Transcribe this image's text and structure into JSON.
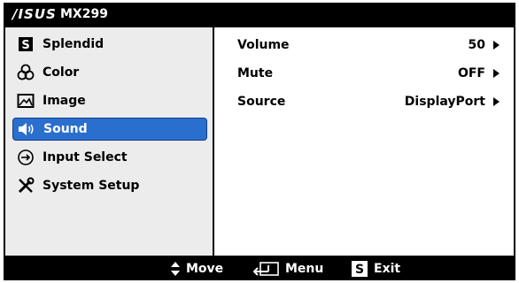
{
  "window": {
    "brand": "/ISUS",
    "model": "MX299"
  },
  "sidebar": {
    "items": [
      {
        "label": "Splendid",
        "icon": "splendid-s-icon"
      },
      {
        "label": "Color",
        "icon": "color-circles-icon"
      },
      {
        "label": "Image",
        "icon": "image-icon"
      },
      {
        "label": "Sound",
        "icon": "speaker-icon",
        "active": true
      },
      {
        "label": "Input Select",
        "icon": "input-arrow-icon"
      },
      {
        "label": "System Setup",
        "icon": "tools-icon"
      }
    ]
  },
  "settings": {
    "rows": [
      {
        "label": "Volume",
        "value": "50"
      },
      {
        "label": "Mute",
        "value": "OFF"
      },
      {
        "label": "Source",
        "value": "DisplayPort"
      }
    ]
  },
  "footer": {
    "move": "Move",
    "menu": "Menu",
    "exit": "Exit"
  },
  "colors": {
    "active": "#2a6fce",
    "sidebar_bg": "#ececec",
    "frame": "#000000"
  }
}
